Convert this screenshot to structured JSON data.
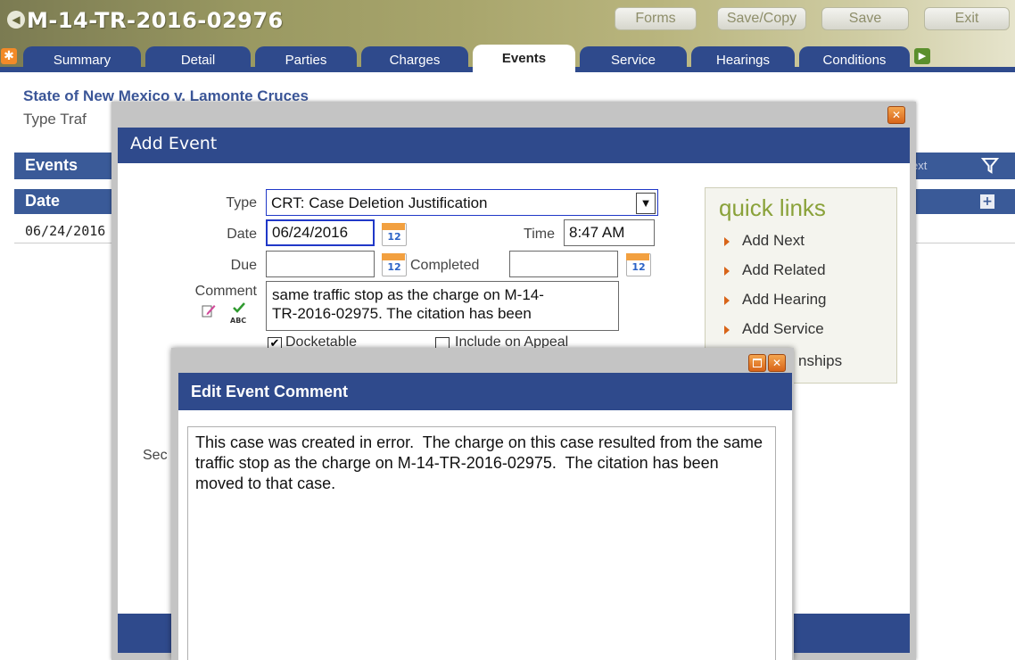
{
  "header": {
    "case_number": "M-14-TR-2016-02976",
    "buttons": {
      "forms": "Forms",
      "save_copy": "Save/Copy",
      "save": "Save",
      "exit": "Exit"
    }
  },
  "tabs": [
    {
      "label": "Summary"
    },
    {
      "label": "Detail"
    },
    {
      "label": "Parties"
    },
    {
      "label": "Charges"
    },
    {
      "label": "Events",
      "active": true
    },
    {
      "label": "Service"
    },
    {
      "label": "Hearings"
    },
    {
      "label": "Conditions"
    }
  ],
  "background": {
    "case_name": "State of New Mexico v. Lamonte Cruces",
    "type_label": "Type",
    "type_value": "Traf",
    "events_title": "Events",
    "next_text": "ext",
    "date_header": "Date",
    "rows": [
      {
        "date": "06/24/2016"
      }
    ]
  },
  "add_event": {
    "title": "Add Event",
    "type_label": "Type",
    "type_value": "CRT:  Case Deletion Justification",
    "date_label": "Date",
    "date_value": "06/24/2016",
    "time_label": "Time",
    "time_value": "8:47 AM",
    "due_label": "Due",
    "due_value": "",
    "completed_label": "Completed",
    "completed_value": "",
    "comment_label": "Comment",
    "comment_visible": "same traffic stop as the charge on M-14-\nTR-2016-02975.  The citation has been",
    "docketable_label": "Docketable",
    "include_appeal_label": "Include on Appeal",
    "sec_label": "Sec",
    "spellcheck_text": "ABC",
    "quick_links": {
      "title": "quick links",
      "items": [
        "Add Next",
        "Add Related",
        "Add Hearing",
        "Add Service",
        "nships"
      ]
    }
  },
  "edit_comment": {
    "title": "Edit Event Comment",
    "text": "This case was created in error.  The charge on this case resulted from the same traffic stop as the charge on M-14-TR-2016-02975.  The citation has been moved to that case."
  },
  "colors": {
    "navy": "#2f4a8c",
    "header_olive": "#9a9962",
    "accent_orange": "#d86418",
    "quick_links_green": "#8aa23a"
  },
  "icons": {
    "back": "back-arrow-icon",
    "star": "star-icon",
    "filter": "filter-icon",
    "plus": "plus-icon",
    "calendar": "calendar-icon",
    "close": "close-icon",
    "maximize": "maximize-icon",
    "dropdown": "dropdown-arrow-icon",
    "edit": "edit-pencil-icon",
    "spellcheck": "spellcheck-icon"
  }
}
